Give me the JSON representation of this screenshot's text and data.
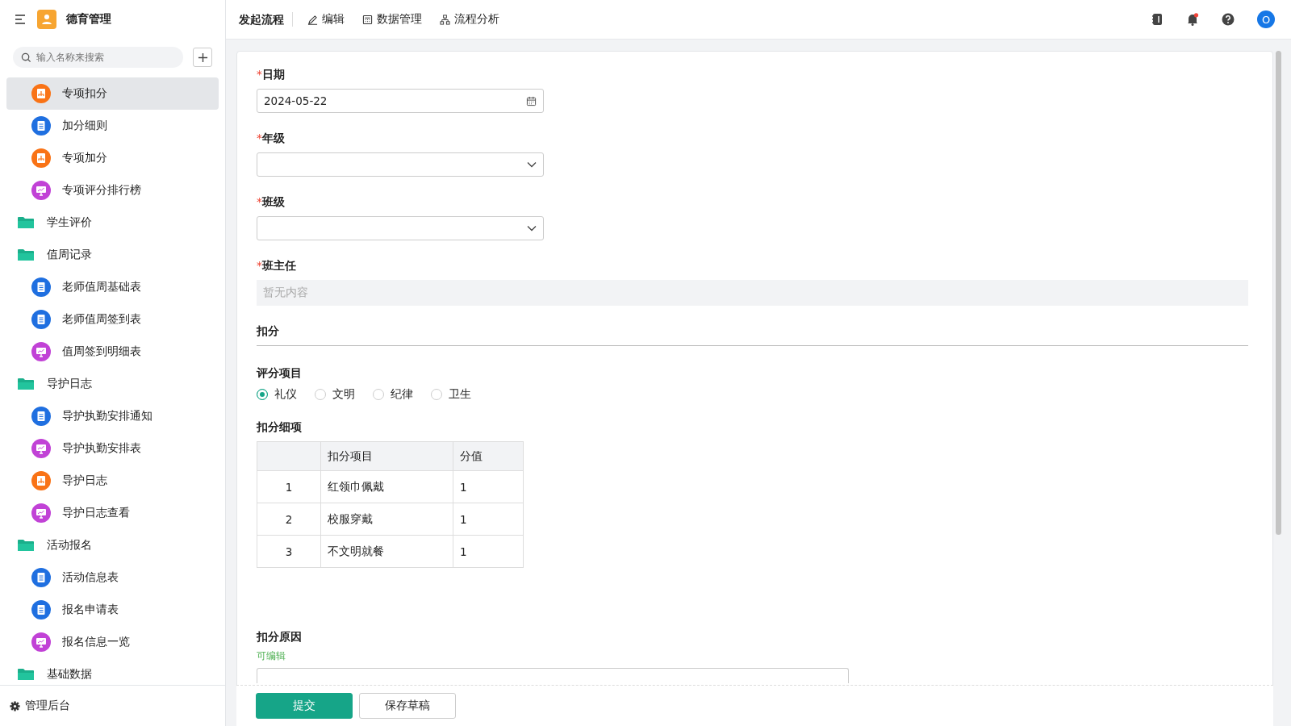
{
  "app": {
    "title": "德育管理"
  },
  "sidebar": {
    "search": {
      "placeholder": "输入名称来搜索"
    },
    "tree": [
      {
        "kind": "group",
        "children": [
          {
            "kind": "form",
            "label": "专项扣分",
            "selected": true
          },
          {
            "kind": "doc",
            "label": "加分细则",
            "selected": false
          },
          {
            "kind": "form",
            "label": "专项加分",
            "selected": false
          },
          {
            "kind": "report",
            "label": "专项评分排行榜",
            "selected": false
          }
        ]
      },
      {
        "kind": "folder",
        "label": "学生评价"
      },
      {
        "kind": "folder",
        "label": "值周记录",
        "children": [
          {
            "kind": "doc",
            "label": "老师值周基础表",
            "selected": false
          },
          {
            "kind": "doc",
            "label": "老师值周签到表",
            "selected": false
          },
          {
            "kind": "report",
            "label": "值周签到明细表",
            "selected": false
          }
        ]
      },
      {
        "kind": "folder",
        "label": "导护日志",
        "children": [
          {
            "kind": "doc",
            "label": "导护执勤安排通知",
            "selected": false
          },
          {
            "kind": "report",
            "label": "导护执勤安排表",
            "selected": false
          },
          {
            "kind": "form",
            "label": "导护日志",
            "selected": false
          },
          {
            "kind": "report",
            "label": "导护日志查看",
            "selected": false
          }
        ]
      },
      {
        "kind": "folder",
        "label": "活动报名",
        "children": [
          {
            "kind": "doc",
            "label": "活动信息表",
            "selected": false
          },
          {
            "kind": "doc",
            "label": "报名申请表",
            "selected": false
          },
          {
            "kind": "report",
            "label": "报名信息一览",
            "selected": false
          }
        ]
      },
      {
        "kind": "folder",
        "label": "基础数据"
      }
    ],
    "footer": "管理后台"
  },
  "topbar": {
    "tabs": [
      {
        "kind": "title",
        "label": "发起流程"
      },
      {
        "kind": "edit",
        "label": "编辑"
      },
      {
        "kind": "data",
        "label": "数据管理"
      },
      {
        "kind": "flow",
        "label": "流程分析"
      }
    ],
    "notification_dot": true,
    "avatar": "O"
  },
  "form": {
    "fields": [
      {
        "kind": "date",
        "label": "日期",
        "required_mark": "*",
        "value": "2024-05-22"
      },
      {
        "kind": "select",
        "label": "年级",
        "required_mark": "*"
      },
      {
        "kind": "select",
        "label": "班级",
        "required_mark": "*"
      },
      {
        "kind": "readonly",
        "label": "班主任",
        "required_mark": "*",
        "placeholder": "暂无内容"
      },
      {
        "kind": "section",
        "label": "扣分"
      },
      {
        "kind": "radio",
        "label": "评分项目",
        "options": [
          {
            "label": "礼仪",
            "selected": true
          },
          {
            "label": "文明",
            "selected": false
          },
          {
            "label": "纪律",
            "selected": false
          },
          {
            "label": "卫生",
            "selected": false
          }
        ]
      },
      {
        "kind": "table",
        "label": "扣分细项",
        "columns": [
          "扣分项目",
          "分值"
        ],
        "rows": [
          {
            "index": "1",
            "item": "红领巾佩戴",
            "score": "1"
          },
          {
            "index": "2",
            "item": "校服穿戴",
            "score": "1"
          },
          {
            "index": "3",
            "item": "不文明就餐",
            "score": "1"
          }
        ]
      },
      {
        "kind": "textarea",
        "label": "扣分原因",
        "hint": "可编辑"
      }
    ]
  },
  "actions": [
    {
      "kind": "primary",
      "label": "提交"
    },
    {
      "kind": "secondary",
      "label": "保存草稿"
    }
  ]
}
